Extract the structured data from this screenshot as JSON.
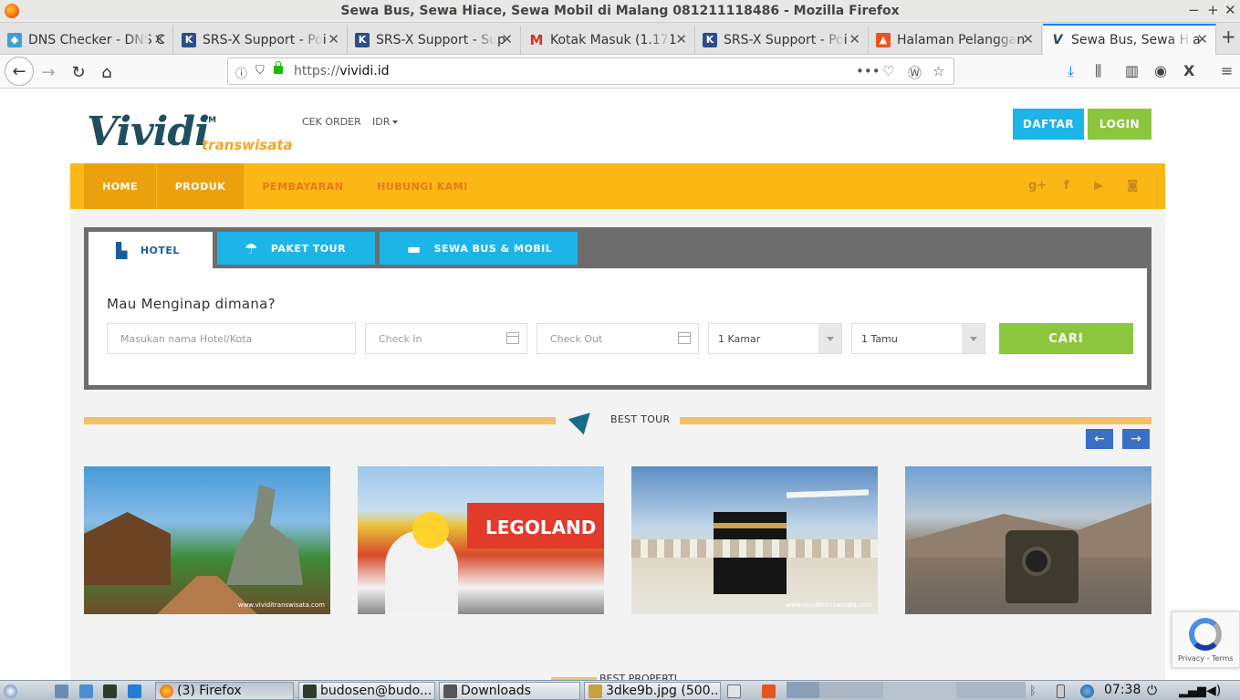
{
  "window": {
    "title": "Sewa Bus, Sewa Hiace, Sewa Mobil di Malang 081211118486 - Mozilla Firefox"
  },
  "tabs": [
    {
      "label": "DNS Checker - DNS C",
      "icon_color": "#3aa0d8"
    },
    {
      "label": "SRS-X Support - Poi",
      "icon_color": "#2b4e8c"
    },
    {
      "label": "SRS-X Support - Sup",
      "icon_color": "#2b4e8c"
    },
    {
      "label": "Kotak Masuk (1.171",
      "icon_color": "#d93025"
    },
    {
      "label": "SRS-X Support - Poi",
      "icon_color": "#2b4e8c"
    },
    {
      "label": "Halaman Pelanggan",
      "icon_color": "#e8541b"
    },
    {
      "label": "Sewa Bus, Sewa Hia",
      "icon_color": "#1f4e5f"
    }
  ],
  "browser": {
    "url_prefix": "https://",
    "url_domain": "vividi.id"
  },
  "site": {
    "logo_text": "Vividi",
    "logo_tm": "TM",
    "logo_sub": "transwisata",
    "top_links": {
      "cek_order": "CEK ORDER",
      "currency": "IDR"
    },
    "buttons": {
      "daftar": "DAFTAR",
      "login": "LOGIN"
    },
    "menu": [
      "HOME",
      "PRODUK",
      "PEMBAYARAN",
      "HUBUNGI KAMI"
    ],
    "social": [
      "g+",
      "f",
      "yt",
      "ig"
    ],
    "search": {
      "tabs": [
        "HOTEL",
        "PAKET TOUR",
        "SEWA BUS & MOBIL"
      ],
      "question": "Mau Menginap dimana?",
      "hotel_placeholder": "Masukan nama Hotel/Kota",
      "checkin_placeholder": "Check In",
      "checkout_placeholder": "Check Out",
      "rooms": "1 Kamar",
      "guests": "1 Tamu",
      "submit": "CARI"
    },
    "best_tour": {
      "title": "BEST TOUR",
      "prev": "←",
      "next": "→"
    },
    "tour_cards": [
      {
        "caption": "www.vividitranswisata.com"
      },
      {
        "caption": ""
      },
      {
        "caption": "www.vividitranswisata.com"
      },
      {
        "caption": ""
      }
    ],
    "best_properti": {
      "title": "BEST PROPERTI"
    }
  },
  "recaptcha": {
    "text": "Privacy - Terms"
  },
  "taskbar": {
    "items": [
      "(3) Firefox",
      "budosen@budo...",
      "Downloads",
      "3dke9b.jpg (500..."
    ],
    "clock": "07:38"
  }
}
